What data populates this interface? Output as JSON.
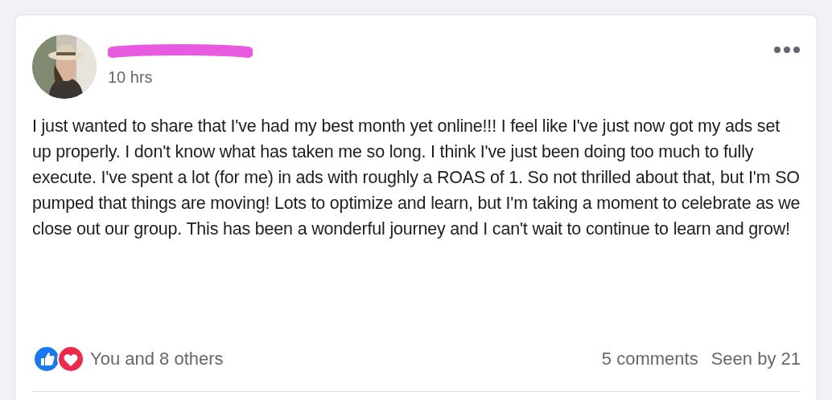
{
  "post": {
    "time": "10 hrs",
    "body": "I just wanted to share that I've had my best month yet online!!! I feel like I've just now got my ads set up properly. I don't know what has taken me so long. I think I've just been doing too much to fully execute. I've spent a lot (for me) in ads with roughly a ROAS of 1. So not thrilled about that, but I'm SO pumped that things are moving! Lots to optimize and learn, but I'm taking a moment to celebrate as we close out our group. This has been a wonderful journey and I can't wait to continue to learn and grow!",
    "reactions": [
      {
        "kind": "like"
      },
      {
        "kind": "love"
      }
    ],
    "reaction_summary": "You and 8 others",
    "comments": "5 comments",
    "seen_by": "Seen by 21"
  }
}
